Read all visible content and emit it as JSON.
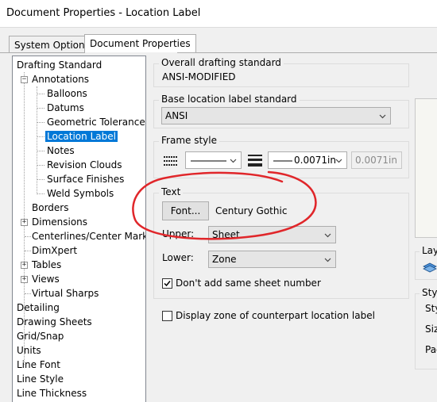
{
  "window": {
    "title": "Document Properties - Location Label"
  },
  "tabs": [
    {
      "label": "System Options"
    },
    {
      "label": "Document Properties"
    }
  ],
  "tree": {
    "items": [
      {
        "label": "Drafting Standard"
      },
      {
        "label": "Annotations"
      },
      {
        "label": "Balloons"
      },
      {
        "label": "Datums"
      },
      {
        "label": "Geometric Tolerances"
      },
      {
        "label": "Location Label"
      },
      {
        "label": "Notes"
      },
      {
        "label": "Revision Clouds"
      },
      {
        "label": "Surface Finishes"
      },
      {
        "label": "Weld Symbols"
      },
      {
        "label": "Borders"
      },
      {
        "label": "Dimensions"
      },
      {
        "label": "Centerlines/Center Marks"
      },
      {
        "label": "DimXpert"
      },
      {
        "label": "Tables"
      },
      {
        "label": "Views"
      },
      {
        "label": "Virtual Sharps"
      },
      {
        "label": "Detailing"
      },
      {
        "label": "Drawing Sheets"
      },
      {
        "label": "Grid/Snap"
      },
      {
        "label": "Units"
      },
      {
        "label": "Line Font"
      },
      {
        "label": "Line Style"
      },
      {
        "label": "Line Thickness"
      }
    ]
  },
  "overall": {
    "label": "Overall drafting standard",
    "value": "ANSI-MODIFIED"
  },
  "base": {
    "label": "Base location label standard",
    "value": "ANSI"
  },
  "frame": {
    "label": "Frame style",
    "thickness_value": "0.0071in",
    "custom_value": "0.0071in"
  },
  "text": {
    "label": "Text",
    "font_button": "Font...",
    "font_name": "Century Gothic",
    "upper_label": "Upper:",
    "upper_value": "Sheet",
    "lower_label": "Lower:",
    "lower_value": "Zone",
    "dont_add_label": "Don't add same sheet number",
    "dont_add_checked": true
  },
  "display_zone": {
    "label": "Display zone of counterpart location label",
    "checked": false
  },
  "right_panel": {
    "layer_label": "Laye",
    "style_label": "Styl",
    "style_row1": "Sty",
    "style_row2": "Size",
    "style_row3": "Pad"
  },
  "colors": {
    "selection": "#0078d7",
    "annotation_circle": "#e0262a"
  }
}
